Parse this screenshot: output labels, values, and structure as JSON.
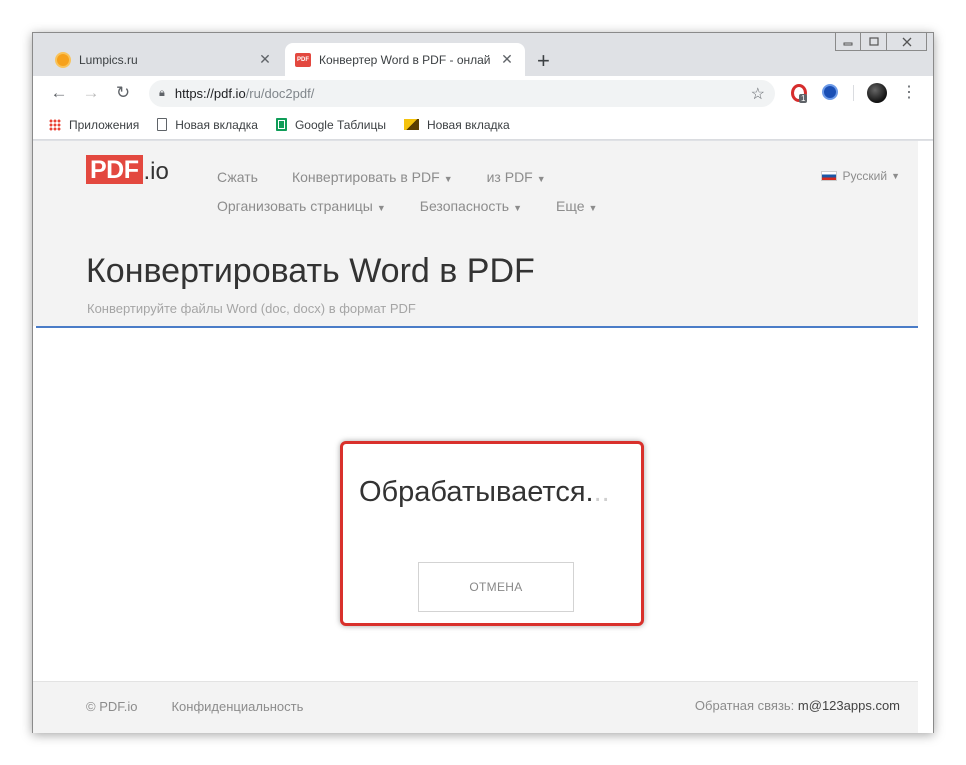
{
  "browser": {
    "tabs": [
      {
        "title": "Lumpics.ru",
        "icon": "lumpics-favicon",
        "active": false
      },
      {
        "title": "Конвертер Word в PDF - онлай",
        "icon": "pdf-favicon",
        "active": true
      }
    ],
    "new_tab_symbol": "+",
    "url_host": "https://pdf.io",
    "url_path": "/ru/doc2pdf/",
    "extension_badge": "1",
    "bookmarks": [
      {
        "label": "Приложения",
        "icon": "apps-grid-icon"
      },
      {
        "label": "Новая вкладка",
        "icon": "document-icon"
      },
      {
        "label": "Google Таблицы",
        "icon": "google-sheets-icon"
      },
      {
        "label": "Новая вкладка",
        "icon": "image-icon"
      }
    ]
  },
  "site": {
    "logo_pdf": "PDF",
    "logo_io": ".io",
    "nav_row1": [
      {
        "label": "Сжать",
        "dropdown": false
      },
      {
        "label": "Конвертировать в PDF",
        "dropdown": true
      },
      {
        "label": "из PDF",
        "dropdown": true
      }
    ],
    "nav_row2": [
      {
        "label": "Организовать страницы",
        "dropdown": true
      },
      {
        "label": "Безопасность",
        "dropdown": true
      },
      {
        "label": "Еще",
        "dropdown": true
      }
    ],
    "language": "Русский",
    "page_title": "Конвертировать Word в PDF",
    "page_subtitle": "Конвертируйте файлы Word (doc, docx) в формат PDF",
    "processing_text": "Обрабатывается",
    "processing_dot_main": ".",
    "processing_dots_faded": "..",
    "cancel_label": "ОТМЕНА",
    "footer": {
      "copyright": "© PDF.io",
      "privacy": "Конфиденциальность",
      "feedback_label": "Обратная связь: ",
      "feedback_email": "m@123apps.com"
    }
  },
  "colors": {
    "brand_red": "#e3483f",
    "highlight_red": "#d9312c",
    "header_line_blue": "#4a7cc7"
  }
}
